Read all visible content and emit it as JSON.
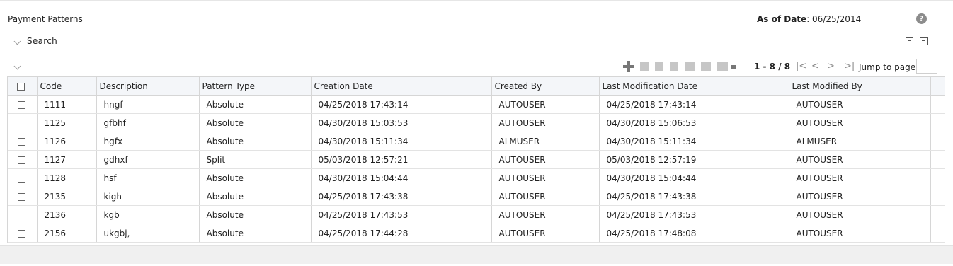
{
  "page": {
    "title": "Payment Patterns"
  },
  "as_of": {
    "label": "As of Date",
    "value": "06/25/2014"
  },
  "help": {
    "glyph": "?"
  },
  "search": {
    "label": "Search"
  },
  "toolbar": {
    "add_icon": "plus-icon"
  },
  "pager": {
    "range": "1 - 8 / 8",
    "first": "first-page-icon",
    "prev": "prev-page-icon",
    "next": "next-page-icon",
    "last": "last-page-icon",
    "jump_label": "Jump to page"
  },
  "table": {
    "columns": [
      "Code",
      "Description",
      "Pattern Type",
      "Creation Date",
      "Created By",
      "Last Modification Date",
      "Last Modified By"
    ],
    "rows": [
      [
        "1111",
        "hngf",
        "Absolute",
        "04/25/2018 17:43:14",
        "AUTOUSER",
        "04/25/2018 17:43:14",
        "AUTOUSER"
      ],
      [
        "1125",
        "gfbhf",
        "Absolute",
        "04/30/2018 15:03:53",
        "AUTOUSER",
        "04/30/2018 15:06:53",
        "AUTOUSER"
      ],
      [
        "1126",
        "hgfx",
        "Absolute",
        "04/30/2018 15:11:34",
        "ALMUSER",
        "04/30/2018 15:11:34",
        "ALMUSER"
      ],
      [
        "1127",
        "gdhxf",
        "Split",
        "05/03/2018 12:57:21",
        "AUTOUSER",
        "05/03/2018 12:57:19",
        "AUTOUSER"
      ],
      [
        "1128",
        "hsf",
        "Absolute",
        "04/30/2018 15:04:44",
        "AUTOUSER",
        "04/30/2018 15:04:44",
        "AUTOUSER"
      ],
      [
        "2135",
        "kigh",
        "Absolute",
        "04/25/2018 17:43:38",
        "AUTOUSER",
        "04/25/2018 17:43:38",
        "AUTOUSER"
      ],
      [
        "2136",
        "kgb",
        "Absolute",
        "04/25/2018 17:43:53",
        "AUTOUSER",
        "04/25/2018 17:43:53",
        "AUTOUSER"
      ],
      [
        "2156",
        "ukgbj,",
        "Absolute",
        "04/25/2018 17:44:28",
        "AUTOUSER",
        "04/25/2018 17:48:08",
        "AUTOUSER"
      ]
    ]
  }
}
